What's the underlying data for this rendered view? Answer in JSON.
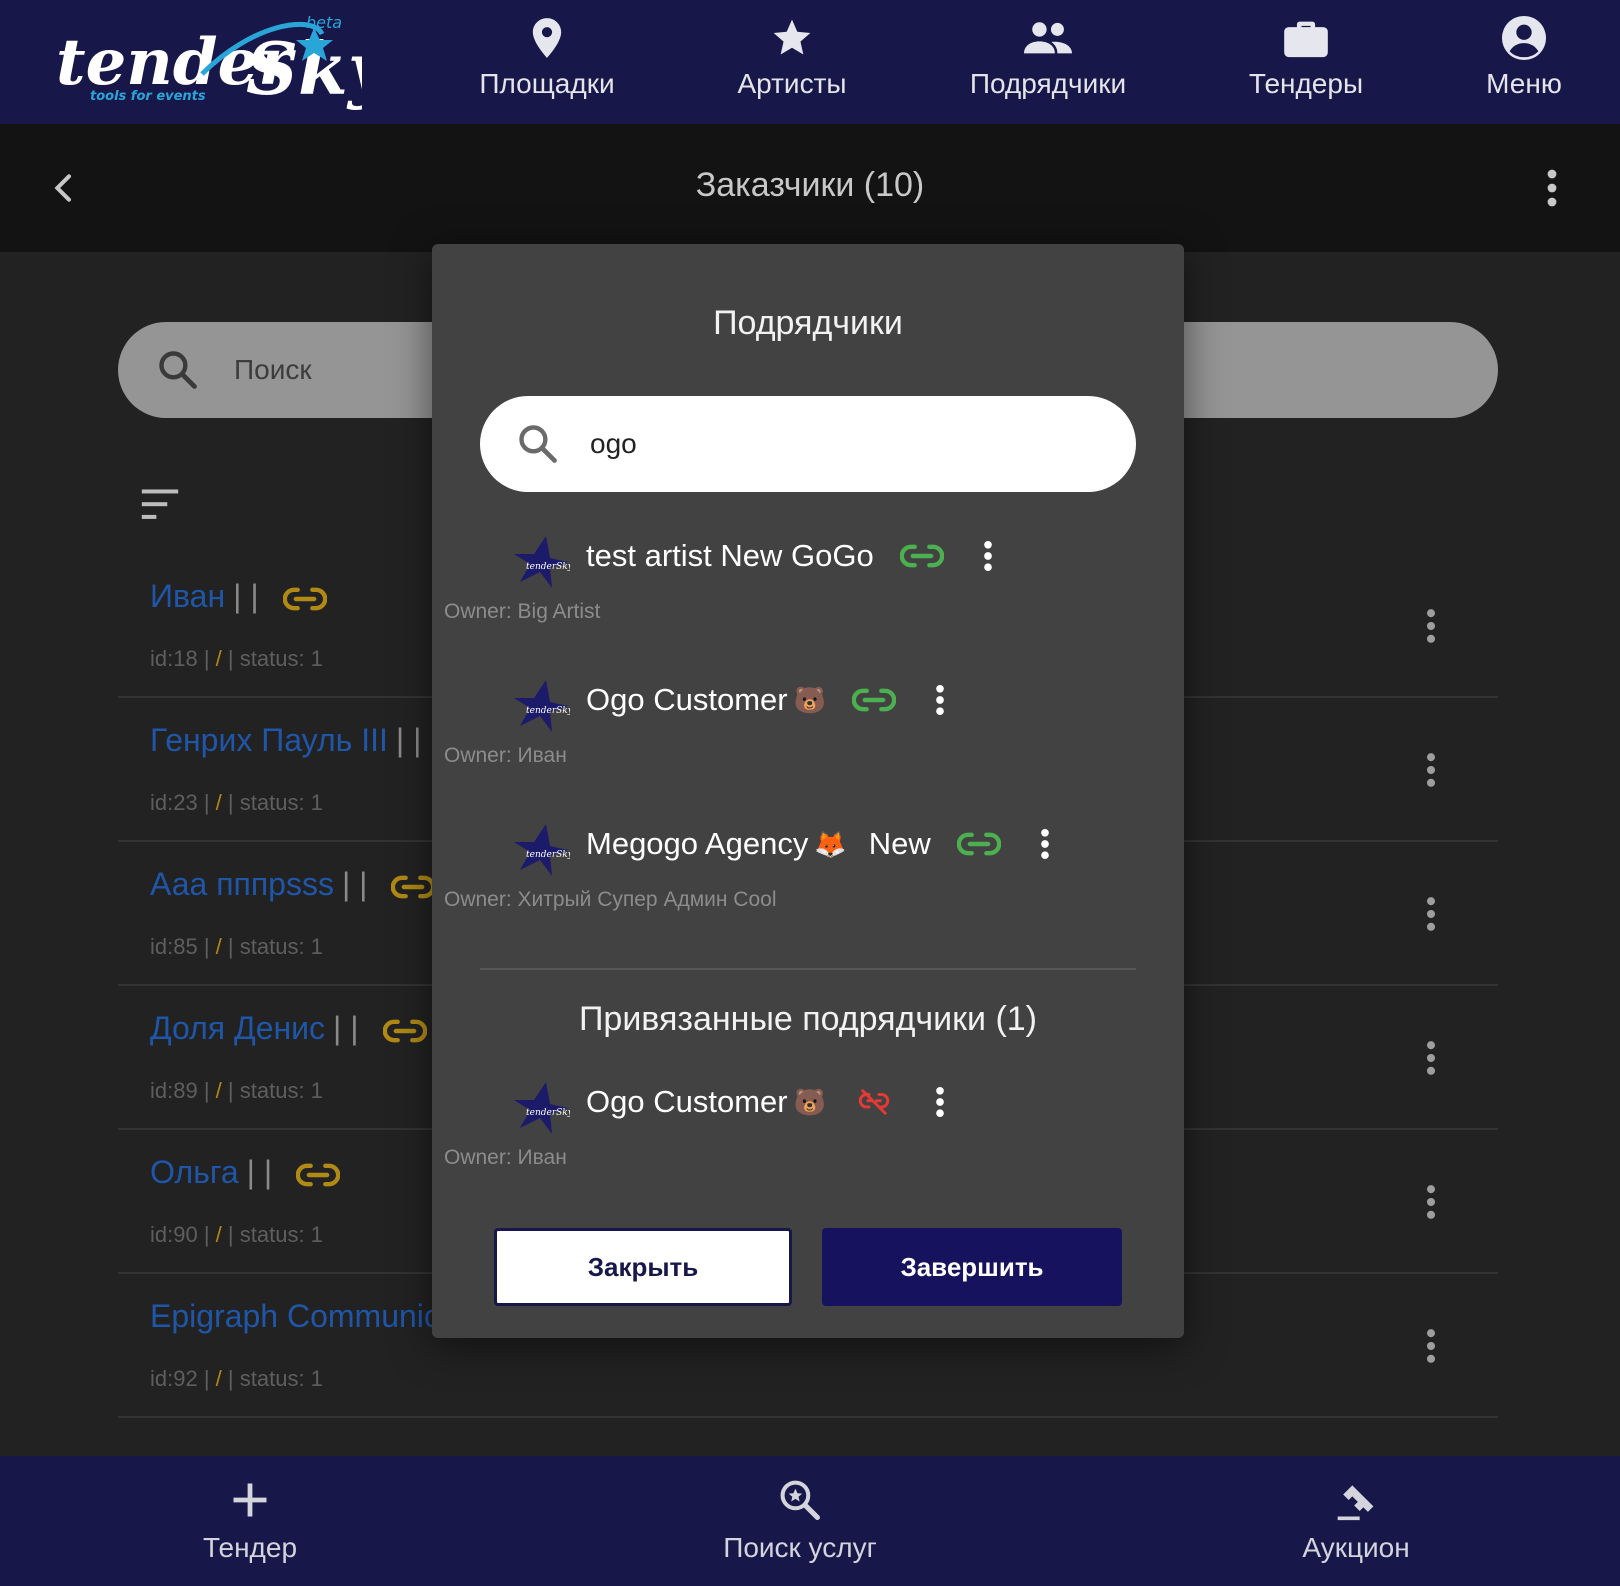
{
  "nav": {
    "logo": {
      "title": "tenderSky",
      "tagline": "tools for events",
      "badge": "beta"
    },
    "items": [
      {
        "label": "Площадки",
        "icon": "map-pin-icon"
      },
      {
        "label": "Артисты",
        "icon": "star-icon"
      },
      {
        "label": "Подрядчики",
        "icon": "people-icon"
      },
      {
        "label": "Тендеры",
        "icon": "briefcase-icon"
      },
      {
        "label": "Меню",
        "icon": "account-circle-icon"
      }
    ]
  },
  "header": {
    "title": "Заказчики (10)"
  },
  "page": {
    "search_placeholder": "Поиск",
    "rows": [
      {
        "name": "Иван",
        "bars": "| |",
        "meta_id": "id:18 |",
        "meta_slash": "/",
        "meta_status": "| status: 1"
      },
      {
        "name": "Генрих Пауль III",
        "bars": "| |",
        "meta_id": "id:23 |",
        "meta_slash": "/",
        "meta_status": "| status: 1"
      },
      {
        "name": "Ааа пппpsss",
        "bars": "| |",
        "meta_id": "id:85 |",
        "meta_slash": "/",
        "meta_status": "| status: 1"
      },
      {
        "name": "Доля Денис",
        "bars": "| |",
        "meta_id": "id:89 |",
        "meta_slash": "/",
        "meta_status": "| status: 1"
      },
      {
        "name": "Ольга",
        "bars": "| |",
        "meta_id": "id:90 |",
        "meta_slash": "/",
        "meta_status": "| status: 1"
      },
      {
        "name": "Epigraph Communic",
        "bars": "",
        "meta_id": "id:92 |",
        "meta_slash": "/",
        "meta_status": "| status: 1"
      }
    ]
  },
  "modal": {
    "title": "Подрядчики",
    "search_value": "ogo",
    "results": [
      {
        "name": "test artist New GoGo",
        "emoji": "",
        "extra": "",
        "owner": "Owner: Big Artist"
      },
      {
        "name": "Ogo Customer",
        "emoji": "🐻",
        "extra": "",
        "owner": "Owner: Иван"
      },
      {
        "name": "Megogo Agency",
        "emoji": "🦊",
        "extra": "New",
        "owner": "Owner: Хитрый Супер Админ Cool"
      }
    ],
    "linked_title": "Привязанные подрядчики (1)",
    "linked": [
      {
        "name": "Ogo Customer",
        "emoji": "🐻",
        "owner": "Owner: Иван"
      }
    ],
    "close_label": "Закрыть",
    "finish_label": "Завершить"
  },
  "bottom_nav": [
    {
      "label": "Тендер",
      "icon": "plus-icon"
    },
    {
      "label": "Поиск услуг",
      "icon": "search-star-icon"
    },
    {
      "label": "Аукцион",
      "icon": "gavel-icon"
    }
  ],
  "colors": {
    "nav_bg": "#17174a",
    "link_active": "#4caf50",
    "link_unlink": "#e53935",
    "link_gold": "#b08a14",
    "row_name": "#1f56a8"
  }
}
